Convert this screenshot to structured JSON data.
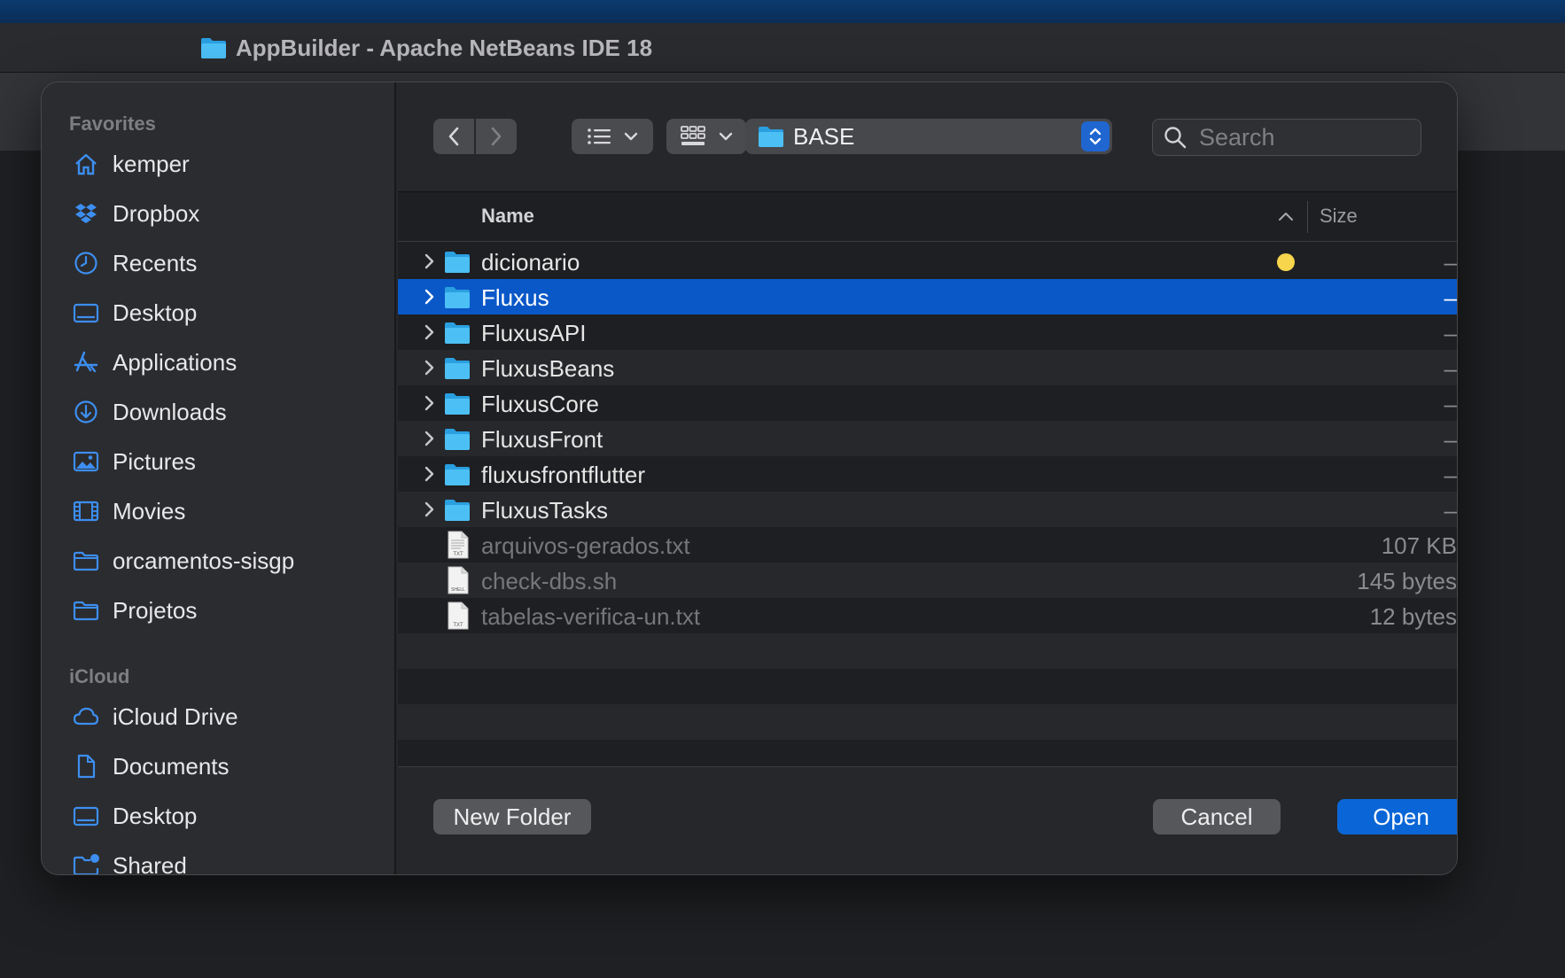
{
  "window": {
    "title": "AppBuilder - Apache NetBeans IDE 18"
  },
  "sidebar": {
    "favorites_label": "Favorites",
    "favorites": [
      {
        "label": "kemper",
        "icon": "home-icon"
      },
      {
        "label": "Dropbox",
        "icon": "dropbox-icon"
      },
      {
        "label": "Recents",
        "icon": "clock-icon"
      },
      {
        "label": "Desktop",
        "icon": "desktop-icon"
      },
      {
        "label": "Applications",
        "icon": "applications-icon"
      },
      {
        "label": "Downloads",
        "icon": "download-icon"
      },
      {
        "label": "Pictures",
        "icon": "pictures-icon"
      },
      {
        "label": "Movies",
        "icon": "film-icon"
      },
      {
        "label": "orcamentos-sisgp",
        "icon": "folder-icon"
      },
      {
        "label": "Projetos",
        "icon": "folder-icon"
      }
    ],
    "icloud_label": "iCloud",
    "icloud": [
      {
        "label": "iCloud Drive",
        "icon": "cloud-icon"
      },
      {
        "label": "Documents",
        "icon": "document-icon"
      },
      {
        "label": "Desktop",
        "icon": "desktop-icon"
      },
      {
        "label": "Shared",
        "icon": "shared-folder-icon"
      }
    ]
  },
  "toolbar": {
    "current_folder": "BASE",
    "search_placeholder": "Search"
  },
  "columns": {
    "name": "Name",
    "size": "Size"
  },
  "files": [
    {
      "name": "dicionario",
      "kind": "folder",
      "size": "–",
      "tag": "yellow"
    },
    {
      "name": "Fluxus",
      "kind": "folder",
      "size": "–",
      "selected": true
    },
    {
      "name": "FluxusAPI",
      "kind": "folder",
      "size": "–"
    },
    {
      "name": "FluxusBeans",
      "kind": "folder",
      "size": "–"
    },
    {
      "name": "FluxusCore",
      "kind": "folder",
      "size": "–"
    },
    {
      "name": "FluxusFront",
      "kind": "folder",
      "size": "–"
    },
    {
      "name": "fluxusfrontflutter",
      "kind": "folder",
      "size": "–"
    },
    {
      "name": "FluxusTasks",
      "kind": "folder",
      "size": "–"
    },
    {
      "name": "arquivos-gerados.txt",
      "kind": "file",
      "badge": "TXT",
      "size": "107 KB"
    },
    {
      "name": "check-dbs.sh",
      "kind": "file",
      "badge": "SHELL",
      "size": "145 bytes"
    },
    {
      "name": "tabelas-verifica-un.txt",
      "kind": "file",
      "badge": "TXT",
      "size": "12 bytes"
    }
  ],
  "footer": {
    "new_folder": "New Folder",
    "cancel": "Cancel",
    "open": "Open"
  },
  "colors": {
    "accent": "#0a66d6",
    "selection": "#0a58c8",
    "folder": "#3fb6f2",
    "tag_yellow": "#f7d54c"
  }
}
